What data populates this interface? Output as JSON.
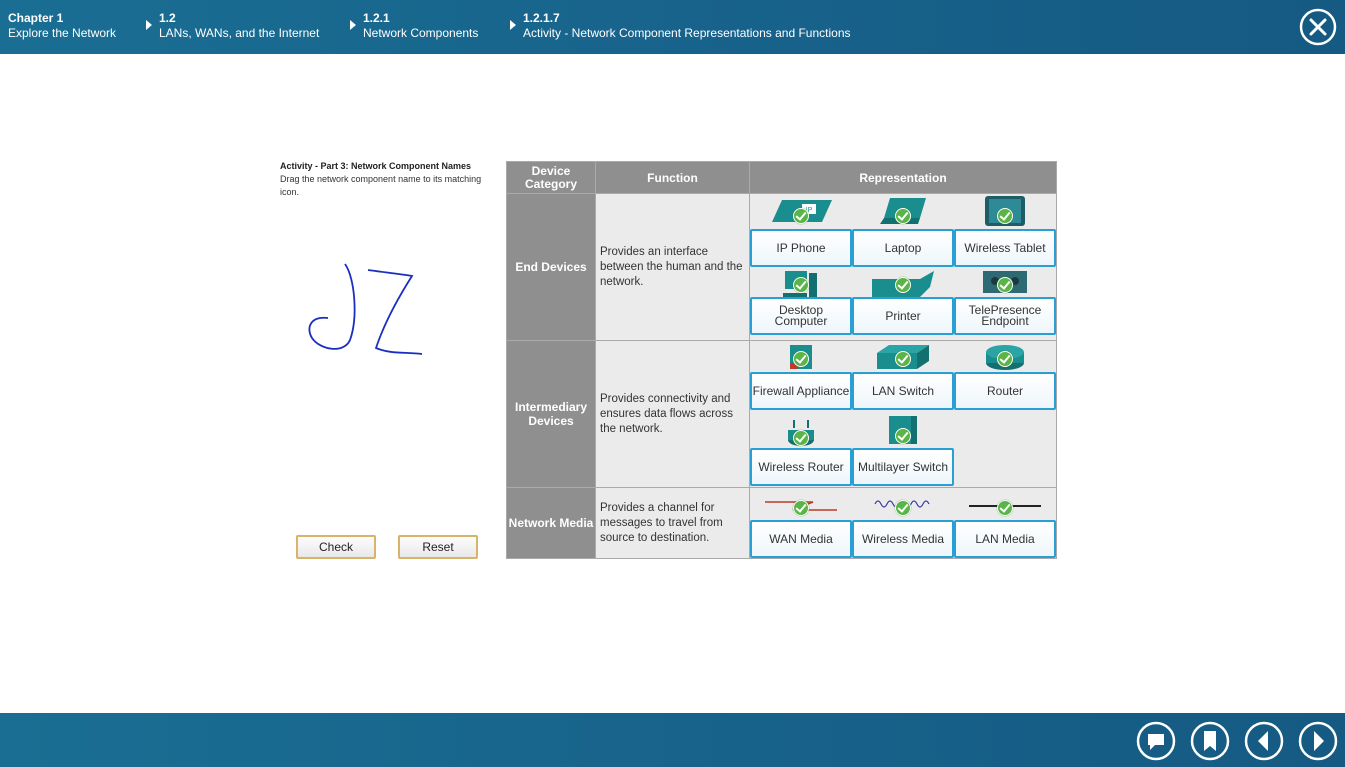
{
  "breadcrumb": [
    {
      "line1": "Chapter 1",
      "line2": "Explore the Network"
    },
    {
      "line1": "1.2",
      "line2": "LANs, WANs, and the Internet"
    },
    {
      "line1": "1.2.1",
      "line2": "Network Components"
    },
    {
      "line1": "1.2.1.7",
      "line2": "Activity - Network Component Representations and Functions"
    }
  ],
  "activity": {
    "title": "Activity - Part 3: Network Component Names",
    "instruction": "Drag the network component name to its matching icon."
  },
  "buttons": {
    "check": "Check",
    "reset": "Reset"
  },
  "table": {
    "headers": {
      "category": "Device Category",
      "function": "Function",
      "representation": "Representation"
    },
    "rows": [
      {
        "category": "End Devices",
        "function": "Provides an interface between the human and the network.",
        "items": [
          "IP Phone",
          "Laptop",
          "Wireless Tablet",
          "Desktop Computer",
          "Printer",
          "TelePresence Endpoint"
        ]
      },
      {
        "category": "Intermediary Devices",
        "function": "Provides connectivity and ensures data flows across the network.",
        "items": [
          "Firewall Appliance",
          "LAN Switch",
          "Router",
          "Wireless Router",
          "Multilayer Switch"
        ]
      },
      {
        "category": "Network Media",
        "function": "Provides a channel for messages to travel from source to destination.",
        "items": [
          "WAN Media",
          "Wireless Media",
          "LAN Media"
        ]
      }
    ]
  },
  "colors": {
    "bar": "#17618a",
    "accent": "#2a9fd6",
    "check": "#59b547",
    "header_gray": "#8f8f8f"
  },
  "icons": [
    "close-icon",
    "comment-icon",
    "bookmark-icon",
    "previous-icon",
    "next-icon"
  ]
}
